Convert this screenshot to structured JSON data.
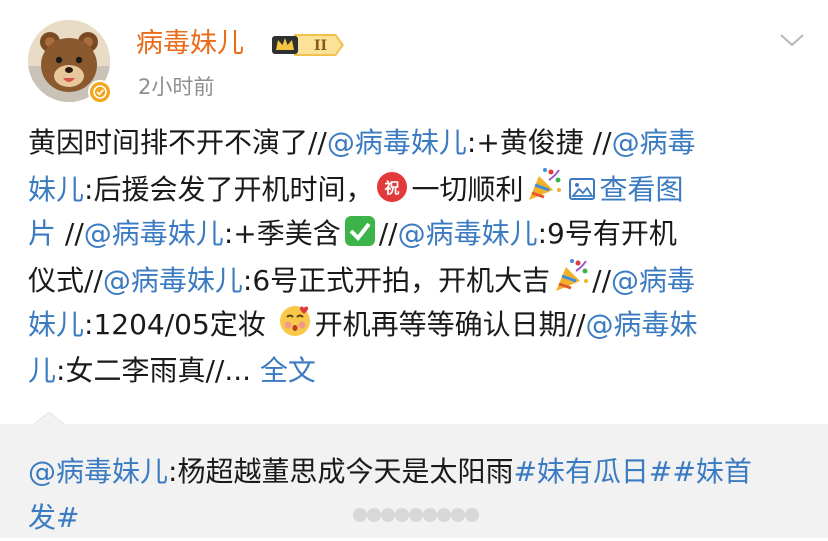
{
  "user": {
    "name": "病毒妹儿",
    "badge_level": "II",
    "time": "2小时前"
  },
  "post": {
    "segments": [
      [
        {
          "t": "黄因时间排不开不演了//",
          "k": "text"
        },
        {
          "t": "@病毒妹儿",
          "k": "mention"
        },
        {
          "t": ":+黄俊捷 //",
          "k": "text"
        },
        {
          "t": "@病毒",
          "k": "mention"
        }
      ],
      [
        {
          "t": "妹儿",
          "k": "mention"
        },
        {
          "t": ":后援会发了开机时间，",
          "k": "text"
        },
        {
          "t": "",
          "k": "emoji-zhu"
        },
        {
          "t": "一切顺利",
          "k": "text"
        },
        {
          "t": "",
          "k": "emoji-party"
        },
        {
          "t": "",
          "k": "emoji-image"
        },
        {
          "t": "查看图",
          "k": "link"
        }
      ],
      [
        {
          "t": "片",
          "k": "link"
        },
        {
          "t": " //",
          "k": "text"
        },
        {
          "t": "@病毒妹儿",
          "k": "mention"
        },
        {
          "t": ":+季美含",
          "k": "text"
        },
        {
          "t": "",
          "k": "emoji-check"
        },
        {
          "t": "//",
          "k": "text"
        },
        {
          "t": "@病毒妹儿",
          "k": "mention"
        },
        {
          "t": ":9号有开机",
          "k": "text"
        }
      ],
      [
        {
          "t": "仪式//",
          "k": "text"
        },
        {
          "t": "@病毒妹儿",
          "k": "mention"
        },
        {
          "t": ":6号正式开拍，开机大吉",
          "k": "text"
        },
        {
          "t": "",
          "k": "emoji-party"
        },
        {
          "t": "//",
          "k": "text"
        },
        {
          "t": "@病毒",
          "k": "mention"
        }
      ],
      [
        {
          "t": "妹儿",
          "k": "mention"
        },
        {
          "t": ":1204/05定妆 ",
          "k": "text"
        },
        {
          "t": "",
          "k": "emoji-face"
        },
        {
          "t": "开机再等等确认日期//",
          "k": "text"
        },
        {
          "t": "@病毒妹",
          "k": "mention"
        }
      ],
      [
        {
          "t": "儿",
          "k": "mention"
        },
        {
          "t": ":女二李雨真//... ",
          "k": "text"
        },
        {
          "t": "全文",
          "k": "link"
        }
      ]
    ]
  },
  "repost": {
    "segments": [
      [
        {
          "t": "@病毒妹儿",
          "k": "mention"
        },
        {
          "t": ":杨超越董思成今天是太阳雨",
          "k": "text"
        },
        {
          "t": "#妹有瓜日#",
          "k": "mention"
        },
        {
          "t": "#妹首",
          "k": "mention"
        }
      ],
      [
        {
          "t": "发#",
          "k": "mention"
        }
      ]
    ]
  },
  "colors": {
    "username": "#ea6b18",
    "link": "#3b7bc2",
    "time": "#8f8f8f",
    "repost_bg": "#f2f2f2"
  },
  "icons": {
    "verify": "verified-badge-icon",
    "level": "crown-level-badge-icon",
    "more": "chevron-down-icon"
  }
}
